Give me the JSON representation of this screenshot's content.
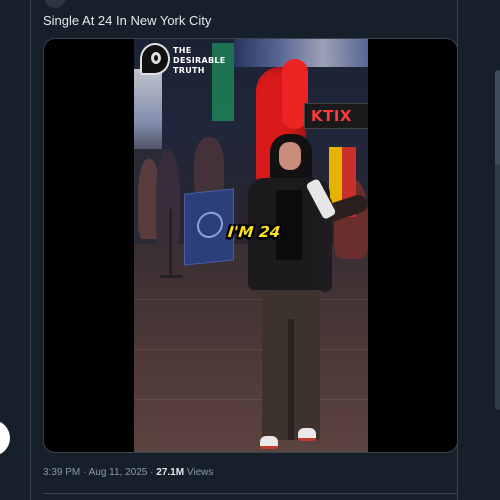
{
  "tweet": {
    "text": "Single At 24 In New York City"
  },
  "video": {
    "logo_line1": "THE",
    "logo_line2": "DESIRABLE",
    "logo_line3": "TRUTH",
    "caption": "I'M 24",
    "sign_text": "KTIX"
  },
  "meta": {
    "time": "3:39 PM",
    "sep1": "·",
    "date": "Aug 11, 2025",
    "sep2": "·",
    "views_count": "27.1M",
    "views_label": "Views"
  },
  "colors": {
    "background": "#15202b",
    "border": "#38444d",
    "text_primary": "#e7e9ea",
    "text_secondary": "#8b98a5",
    "caption_yellow": "#ffe21a"
  },
  "icons": {
    "logo": "desirable-truth-logo"
  }
}
